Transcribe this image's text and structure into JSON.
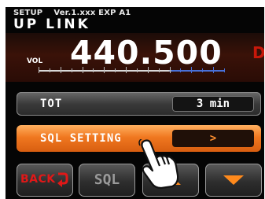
{
  "header": {
    "setup_label": "SETUP",
    "version_label": "Ver.1.xxx EXP A1",
    "mode_label": "UP LINK",
    "frequency": "440.500",
    "mode_indicator": "DN",
    "volume_label": "VOL"
  },
  "menu": {
    "items": [
      {
        "label": "TOT",
        "value": "3 min"
      },
      {
        "label": "SQL SETTING",
        "value": ">"
      }
    ]
  },
  "softkeys": {
    "back_label": "BACK",
    "sql_label": "SQL",
    "up_icon": "up-arrow-icon",
    "down_icon": "down-arrow-icon"
  },
  "colors": {
    "accent_orange": "#f07820",
    "back_red": "#e01818",
    "mode_red": "#c8180a",
    "meter_blue": "#4870d8"
  }
}
